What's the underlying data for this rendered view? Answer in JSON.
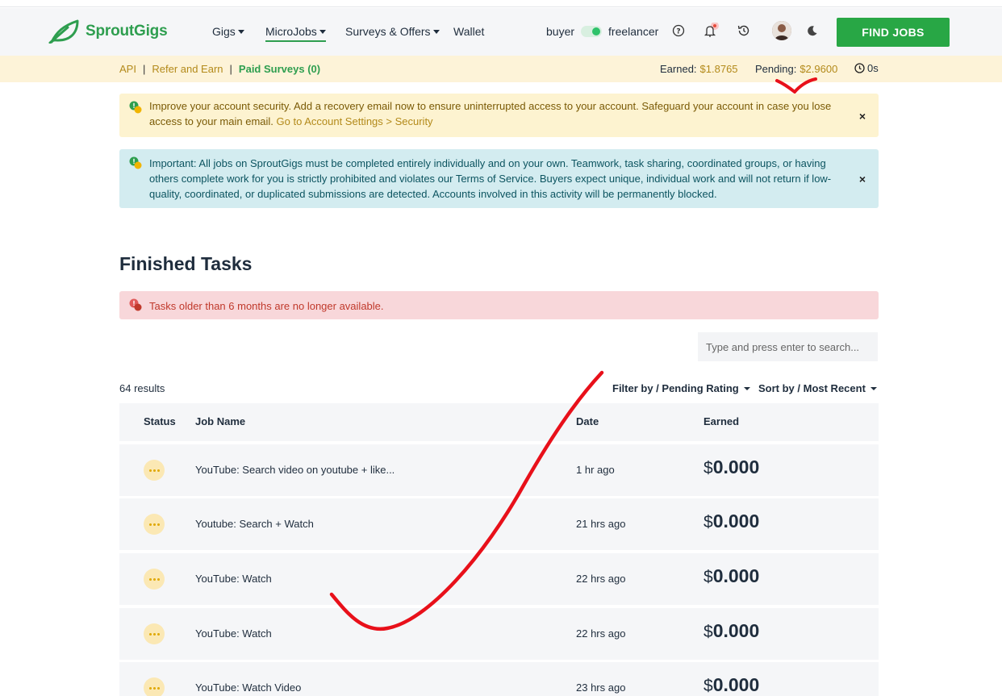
{
  "brand": {
    "name": "SproutGigs"
  },
  "nav": {
    "items": [
      {
        "label": "Gigs",
        "has_caret": true
      },
      {
        "label": "MicroJobs",
        "has_caret": true
      },
      {
        "label": "Surveys & Offers",
        "has_caret": true
      },
      {
        "label": "Wallet",
        "has_caret": false
      }
    ],
    "role_left": "buyer",
    "role_right": "freelancer",
    "find_jobs": "FIND JOBS",
    "icons": [
      "help-icon",
      "bell-icon",
      "history-icon",
      "avatar",
      "moon-icon"
    ]
  },
  "subbar": {
    "api": "API",
    "refer": "Refer and Earn",
    "surveys": "Paid Surveys (0)",
    "earned_label": "Earned:",
    "earned_value": "$1.8765",
    "pending_label": "Pending:",
    "pending_value": "$2.9600",
    "timer": "0s"
  },
  "alerts": {
    "security_text": "Improve your account security. Add a recovery email now to ensure uninterrupted access to your account. Safeguard your account in case you lose access to your main email.",
    "security_link": "Go to Account Settings > Security",
    "important_text": "Important: All jobs on SproutGigs must be completed entirely individually and on your own. Teamwork, task sharing, coordinated groups, or having others complete work for you is strictly prohibited and violates our Terms of Service. Buyers expect unique, individual work and will not return if low-quality, coordinated, or duplicated submissions are detected. Accounts involved in this activity will be permanently blocked.",
    "tasks_notice": "Tasks older than 6 months are no longer available.",
    "close": "×"
  },
  "page": {
    "title": "Finished Tasks"
  },
  "search": {
    "placeholder": "Type and press enter to search..."
  },
  "results": "64 results",
  "filter": "Filter by / Pending Rating",
  "sort": "Sort by / Most Recent",
  "table": {
    "headers": {
      "status": "Status",
      "job": "Job Name",
      "date": "Date",
      "earned": "Earned"
    },
    "currency": "$",
    "rows": [
      {
        "job": "YouTube: Search video on youtube + like...",
        "date": "1 hr ago",
        "earned": "0.000"
      },
      {
        "job": "Youtube: Search + Watch",
        "date": "21 hrs ago",
        "earned": "0.000"
      },
      {
        "job": "YouTube: Watch",
        "date": "22 hrs ago",
        "earned": "0.000"
      },
      {
        "job": "YouTube: Watch",
        "date": "22 hrs ago",
        "earned": "0.000"
      },
      {
        "job": "YouTube: Watch Video",
        "date": "23 hrs ago",
        "earned": "0.000"
      }
    ]
  },
  "colors": {
    "brand_green": "#2e9e4f",
    "button_green": "#28a745",
    "annotation_red": "#e8101a"
  }
}
